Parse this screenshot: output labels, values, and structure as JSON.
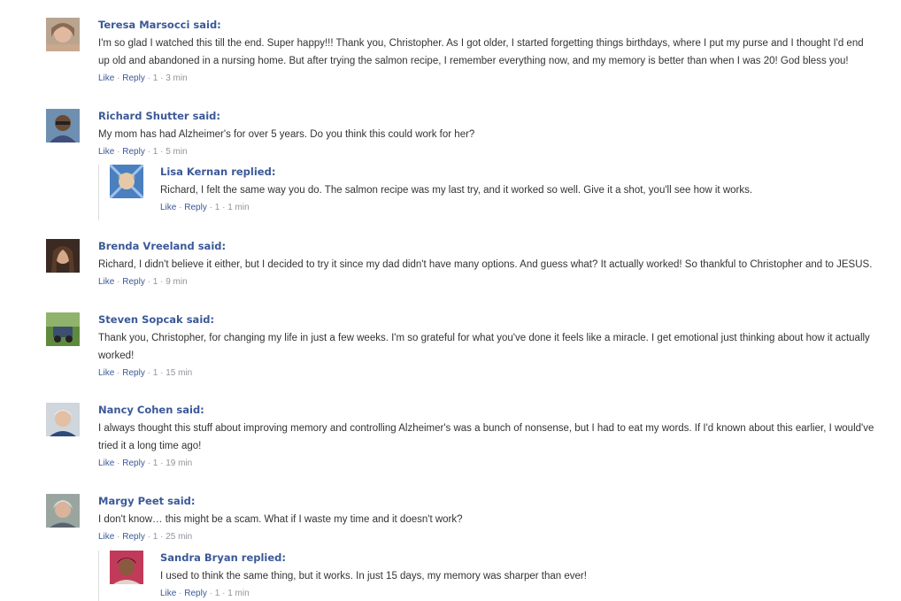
{
  "comments": [
    {
      "name": "Teresa Marsocci said:",
      "text": "I'm so glad I watched this till the end. Super happy!!! Thank you, Christopher. As I got older, I started forgetting things birthdays, where I put my purse and I thought I'd end up old and abandoned in a nursing home. But after trying the salmon recipe, I remember everything now, and my memory is better than when I was 20! God bless you!",
      "like": "Like",
      "reply": "Reply",
      "count": "1",
      "time": "3 min"
    },
    {
      "name": "Richard Shutter said:",
      "text": "My mom has had Alzheimer's for over 5 years. Do you think this could work for her?",
      "like": "Like",
      "reply": "Reply",
      "count": "1",
      "time": "5 min"
    },
    {
      "name": "Lisa Kernan replied:",
      "text": "Richard, I felt the same way you do. The salmon recipe was my last try, and it worked so well. Give it a shot, you'll see how it works.",
      "like": "Like",
      "reply": "Reply",
      "count": "1",
      "time": "1 min"
    },
    {
      "name": "Brenda Vreeland said:",
      "text": "Richard, I didn't believe it either, but I decided to try it since my dad didn't have many options. And guess what? It actually worked! So thankful to Christopher and to JESUS.",
      "like": "Like",
      "reply": "Reply",
      "count": "1",
      "time": "9 min"
    },
    {
      "name": "Steven Sopcak said:",
      "text": "Thank you, Christopher, for changing my life in just a few weeks. I'm so grateful for what you've done it feels like a miracle. I get emotional just thinking about how it actually worked!",
      "like": "Like",
      "reply": "Reply",
      "count": "1",
      "time": "15 min"
    },
    {
      "name": "Nancy Cohen said:",
      "text": "I always thought this stuff about improving memory and controlling Alzheimer's was a bunch of nonsense, but I had to eat my words. If I'd known about this earlier, I would've tried it a long time ago!",
      "like": "Like",
      "reply": "Reply",
      "count": "1",
      "time": "19 min"
    },
    {
      "name": "Margy Peet said:",
      "text": "I don't know… this might be a scam. What if I waste my time and it doesn't work?",
      "like": "Like",
      "reply": "Reply",
      "count": "1",
      "time": "25 min"
    },
    {
      "name": "Sandra Bryan replied:",
      "text": "I used to think the same thing, but it works. In just 15 days, my memory was sharper than ever!",
      "like": "Like",
      "reply": "Reply",
      "count": "1",
      "time": "1 min"
    }
  ],
  "separator": "·",
  "colors": {
    "name": "#3b5998",
    "text": "#333333",
    "meta": "#90949c"
  }
}
